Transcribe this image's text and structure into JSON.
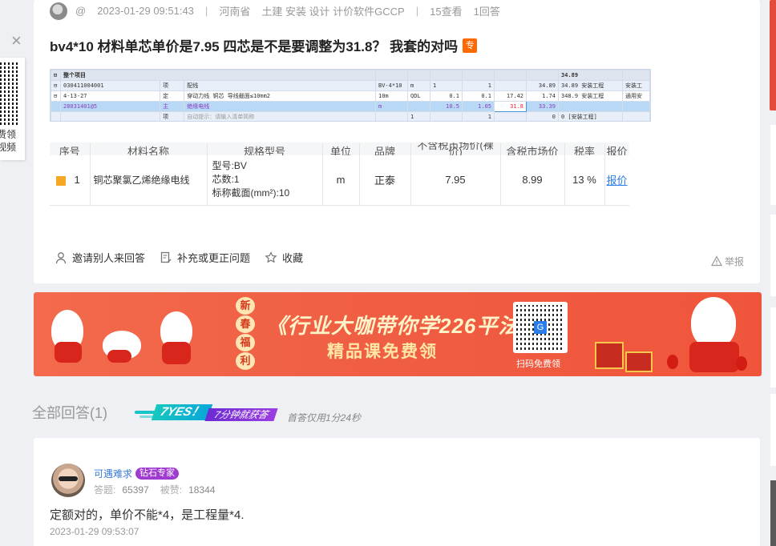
{
  "question": {
    "meta": {
      "user": "@",
      "datetime": "2023-01-29 09:51:43",
      "region": "河南省",
      "tags": "土建 安装 设计 计价软件GCCP",
      "views": "15查看",
      "answers": "1回答"
    },
    "title": "bv4*10 材料单芯单价是7.95 四芯是不是要调整为31.8？ 我套的对吗",
    "title_badge": "专",
    "screenshot1": {
      "header": [
        "整个项目",
        "",
        "",
        "",
        "",
        "",
        "",
        "",
        "",
        "34.89",
        "",
        ""
      ],
      "rows": [
        [
          "030411004001",
          "项",
          "配线",
          "BV-4*10",
          "m",
          "1",
          "",
          "1",
          "",
          "34.89",
          "34.89 安装工程",
          "安装工"
        ],
        [
          "4-13-27",
          "定",
          "穿动力线 铜芯 导线截面≤10mm2",
          "",
          "10m",
          "QDL",
          "0.1",
          "0.1",
          "17.42",
          "1.74",
          "348.9 安装工程",
          "通用安"
        ],
        [
          "28031401@5",
          "主",
          "绝缘电线",
          "",
          "m",
          "",
          "10.5",
          "1.05",
          "31.8",
          "33.39",
          "",
          ""
        ],
        [
          "",
          "项",
          "自动提示：请输入清单简称",
          "",
          "",
          "1",
          "",
          "1",
          "",
          "0",
          "0 [安装工程]",
          ""
        ]
      ]
    },
    "screenshot2": {
      "headers": [
        "序号",
        "材料名称",
        "规格型号",
        "单位",
        "品牌",
        "不含税市场价(裸价)",
        "含税市场价",
        "税率",
        "报价"
      ],
      "row": {
        "index": "1",
        "name": "铜芯聚氯乙烯绝缘电线",
        "spec_lines": [
          "型号:BV",
          "芯数:1",
          "标称截面(mm²):10"
        ],
        "unit": "m",
        "brand": "正泰",
        "price_ex_tax": "7.95",
        "price_inc_tax": "8.99",
        "tax_rate": "13 %",
        "quote": "报价"
      }
    },
    "actions": {
      "invite": "邀请别人来回答",
      "supplement": "补充或更正问题",
      "favorite": "收藏",
      "report": "举报"
    }
  },
  "side_float": {
    "text_lines": [
      "费领",
      "视频"
    ]
  },
  "banner": {
    "seal": [
      "新",
      "春",
      "福",
      "利"
    ],
    "title": "《行业大咖带你学226平法》",
    "subtitle": "精品课免费领",
    "scan_text": "扫码免费领"
  },
  "answers_section": {
    "heading": "全部回答(1)",
    "badge_yes": "7YES！",
    "badge_fast": "7分钟就获答",
    "first_answer": "首答仅用1分24秒"
  },
  "answer": {
    "name": "可遇难求",
    "badge": "钻石专家",
    "answers_label": "答题:",
    "answers_count": "65397",
    "likes_label": "被赞:",
    "likes_count": "18344",
    "text": "定额对的，单价不能*4，是工程量*4.",
    "time": "2023-01-29 09:53:07"
  },
  "colors": {
    "accent_orange": "#ff6a00",
    "link_blue": "#2b7de9",
    "banner_red": "#ef5d42",
    "expert_purple": "#a03bd0"
  }
}
